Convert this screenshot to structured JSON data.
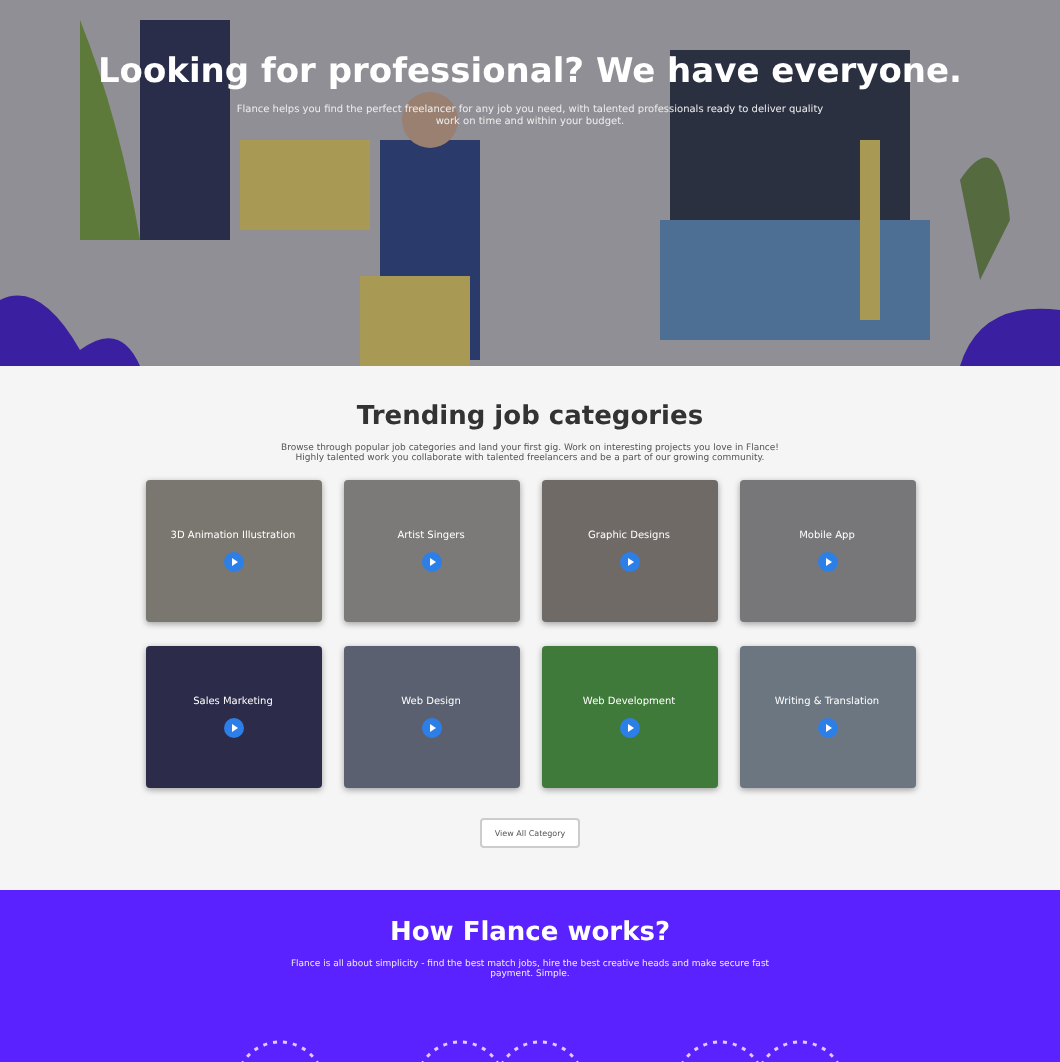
{
  "hero": {
    "title": "Looking for professional? We have everyone.",
    "subtitle": "Flance helps you find the perfect freelancer for any job you need, with talented professionals ready to deliver quality work on time and within your budget."
  },
  "categories": {
    "title": "Trending job categories",
    "description": "Browse through popular job categories and land your first gig. Work on interesting projects you love in Flance! Highly talented work you collaborate with talented freelancers and be a part of our growing community.",
    "items": [
      {
        "label": "3D Animation Illustration",
        "color": "#7a7670"
      },
      {
        "label": "Artist Singers",
        "color": "#7c7a78"
      },
      {
        "label": "Graphic Designs",
        "color": "#6f6a66"
      },
      {
        "label": "Mobile App",
        "color": "#77777a"
      },
      {
        "label": "Sales Marketing",
        "color": "#2c2b4a"
      },
      {
        "label": "Web Design",
        "color": "#5a6070"
      },
      {
        "label": "Web Development",
        "color": "#3f7a3a"
      },
      {
        "label": "Writing & Translation",
        "color": "#6b7680"
      }
    ],
    "button": "View All Category"
  },
  "how": {
    "title": "How Flance works?",
    "description": "Flance is all about simplicity - find the best match jobs, hire the best creative heads and make secure fast payment. Simple."
  }
}
